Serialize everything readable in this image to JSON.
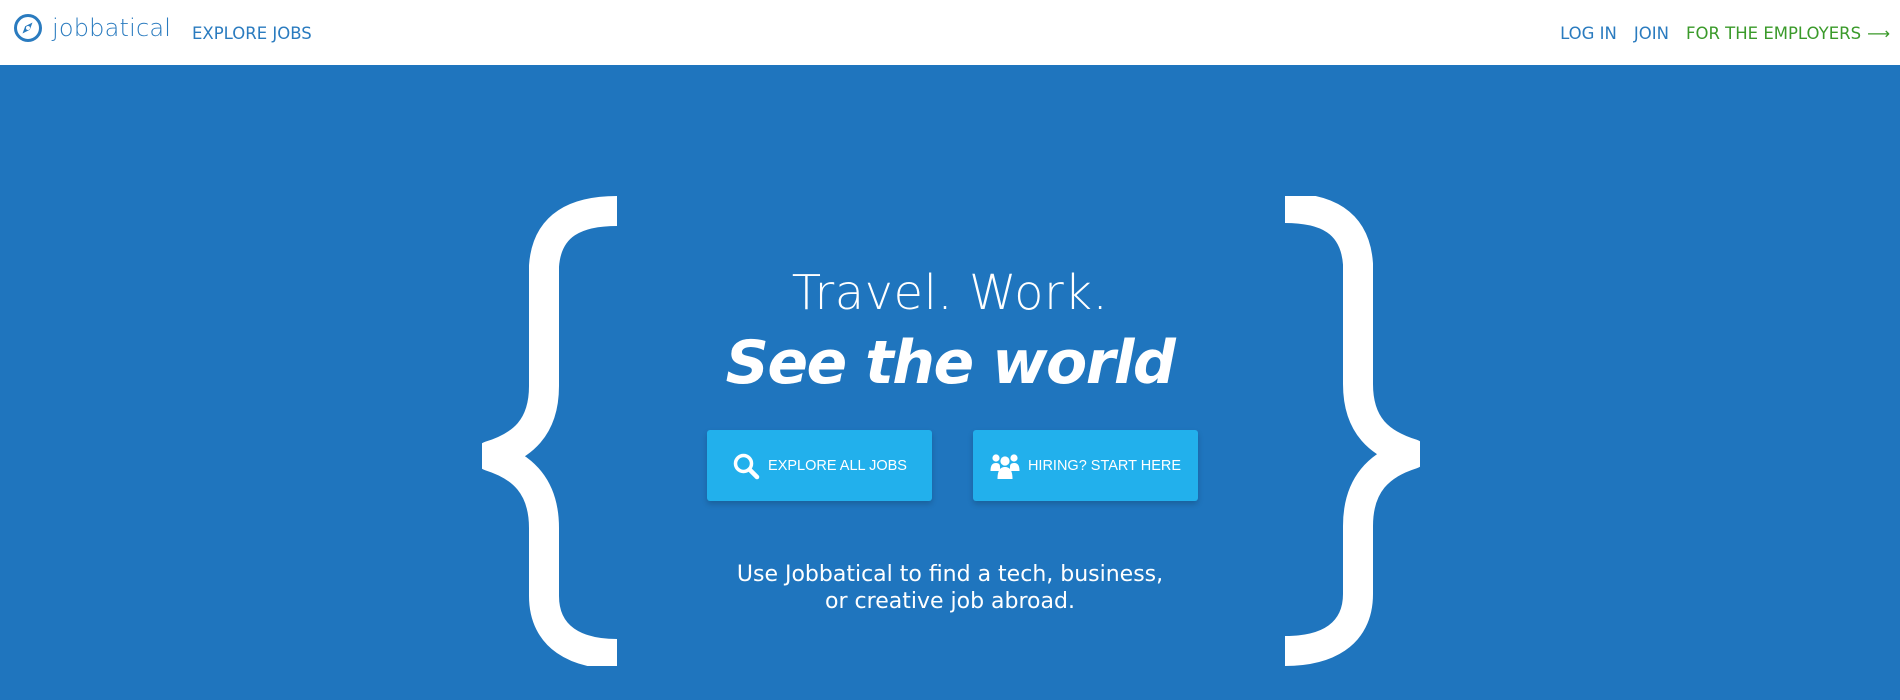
{
  "header": {
    "logo_text": "jobbatical",
    "logo_icon": "compass-icon",
    "explore_label": "EXPLORE JOBS",
    "login_label": "LOG IN",
    "join_label": "JOIN",
    "employers_label": "FOR THE EMPLOYERS",
    "employers_arrow": "⟶"
  },
  "hero": {
    "headline_line1": "Travel. Work.",
    "headline_line2": "See the world",
    "buttons": [
      {
        "label": "EXPLORE ALL JOBS",
        "icon": "search-icon"
      },
      {
        "label": "HIRING? START HERE",
        "icon": "group-icon"
      }
    ],
    "subtext_line1": "Use Jobbatical to find a tech, business,",
    "subtext_line2": "or creative job abroad."
  },
  "colors": {
    "brand_blue": "#2a7bbf",
    "hero_bg": "#1f75be",
    "button_bg": "#22b0ec",
    "employers_green": "#3a9a2a",
    "text_on_hero": "#ffffff"
  }
}
